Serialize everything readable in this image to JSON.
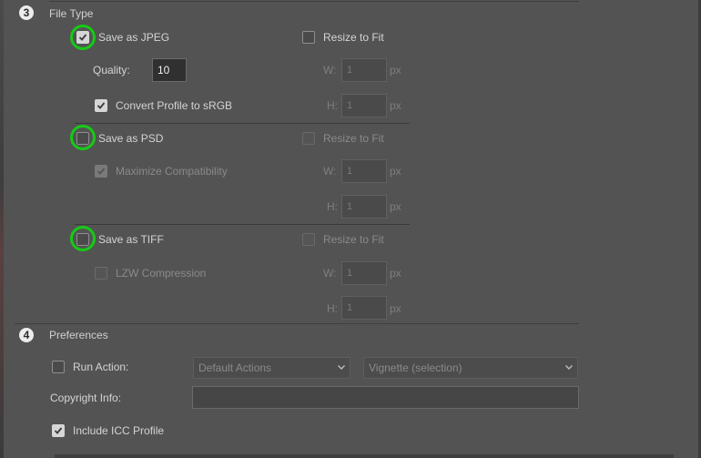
{
  "section3": {
    "number": "3",
    "title": "File Type"
  },
  "jpeg": {
    "save_label": "Save as JPEG",
    "save_checked": true,
    "resize_label": "Resize to Fit",
    "resize_checked": false,
    "quality_label": "Quality:",
    "quality_value": "10",
    "convert_label": "Convert Profile to sRGB",
    "convert_checked": true,
    "w_label": "W:",
    "w_value": "1",
    "h_label": "H:",
    "h_value": "1",
    "unit": "px"
  },
  "psd": {
    "save_label": "Save as PSD",
    "save_checked": false,
    "resize_label": "Resize to Fit",
    "resize_checked": false,
    "max_compat_label": "Maximize Compatibility",
    "max_compat_checked": true,
    "w_label": "W:",
    "w_value": "1",
    "h_label": "H:",
    "h_value": "1",
    "unit": "px"
  },
  "tiff": {
    "save_label": "Save as TIFF",
    "save_checked": false,
    "resize_label": "Resize to Fit",
    "resize_checked": false,
    "lzw_label": "LZW Compression",
    "lzw_checked": false,
    "w_label": "W:",
    "w_value": "1",
    "h_label": "H:",
    "h_value": "1",
    "unit": "px"
  },
  "section4": {
    "number": "4",
    "title": "Preferences"
  },
  "prefs": {
    "run_action_label": "Run Action:",
    "run_action_checked": false,
    "action_set": "Default Actions",
    "action": "Vignette (selection)",
    "copyright_label": "Copyright Info:",
    "copyright_value": "",
    "icc_label": "Include ICC Profile",
    "icc_checked": true
  },
  "colors": {
    "highlight_ring": "#17c917",
    "background": "#535353"
  }
}
